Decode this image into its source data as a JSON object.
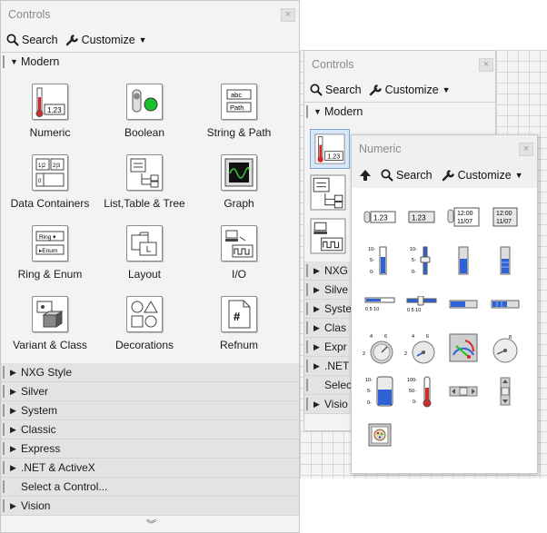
{
  "main": {
    "title": "Controls",
    "search_label": "Search",
    "customize_label": "Customize",
    "section": "Modern",
    "categories": [
      {
        "label": "Numeric",
        "icon": "numeric-icon"
      },
      {
        "label": "Boolean",
        "icon": "boolean-icon"
      },
      {
        "label": "String & Path",
        "icon": "string-path-icon"
      },
      {
        "label": "Data Containers",
        "icon": "data-containers-icon"
      },
      {
        "label": "List,Table & Tree",
        "icon": "list-table-tree-icon"
      },
      {
        "label": "Graph",
        "icon": "graph-icon"
      },
      {
        "label": "Ring & Enum",
        "icon": "ring-enum-icon"
      },
      {
        "label": "Layout",
        "icon": "layout-icon"
      },
      {
        "label": "I/O",
        "icon": "io-icon"
      },
      {
        "label": "Variant & Class",
        "icon": "variant-class-icon"
      },
      {
        "label": "Decorations",
        "icon": "decorations-icon"
      },
      {
        "label": "Refnum",
        "icon": "refnum-icon"
      }
    ],
    "palettes": [
      "NXG Style",
      "Silver",
      "System",
      "Classic",
      "Express",
      ".NET & ActiveX"
    ],
    "select_control": "Select a Control...",
    "vision": "Vision"
  },
  "second": {
    "title": "Controls",
    "search_label": "Search",
    "customize_label": "Customize",
    "section": "Modern",
    "partial_items": [
      "NXG",
      "Silve",
      "Syste",
      "Clas",
      "Expr",
      ".NET",
      "Selec",
      "Visio"
    ]
  },
  "numeric": {
    "title": "Numeric",
    "search_label": "Search",
    "customize_label": "Customize",
    "readouts": {
      "control": "1.23",
      "indicator": "1.23",
      "time": "12:00",
      "date": "11/07",
      "scale_a": "10-",
      "scale_b": "5-",
      "scale_c": "0-",
      "h_scale": "0 5 10",
      "knob_a": "4",
      "knob_b": "6",
      "knob_c": "2",
      "knob_d": "8",
      "tank_a": "10-",
      "tank_b": "5-",
      "tank_c": "0-",
      "thermo_a": "100-",
      "thermo_b": "50-",
      "thermo_c": "0-"
    }
  },
  "colors": {
    "accent_green": "#19c02c",
    "accent_blue": "#2f62d6",
    "accent_red": "#d62a2a"
  }
}
